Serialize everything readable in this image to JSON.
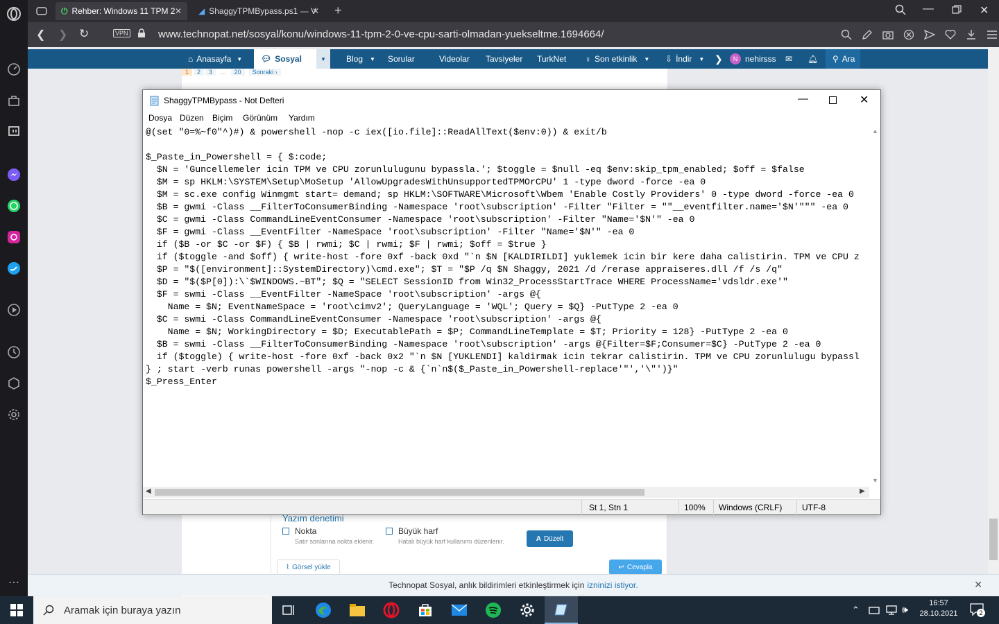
{
  "browser": {
    "tabs": [
      {
        "label": "Rehber: Windows 11 TPM 2"
      },
      {
        "label": "ShaggyTPMBypass.ps1 — V"
      }
    ],
    "vpn_label": "VPN",
    "url": "www.technopat.net/sosyal/konu/windows-11-tpm-2-0-ve-cpu-sarti-olmadan-yuekseltme.1694664/"
  },
  "site_nav": {
    "items": [
      "Anasayfa",
      "Sosyal",
      "Blog",
      "Sorular",
      "Videolar",
      "Tavsiyeler",
      "TurkNet",
      "Son etkinlik",
      "İndir"
    ],
    "user": "nehirsss",
    "user_initial": "N",
    "search": "Ara"
  },
  "pagination": {
    "pages": [
      "1",
      "2",
      "3",
      "...",
      "20"
    ],
    "next": "Sonraki ›"
  },
  "editor_tools": {
    "spell_title": "Yazım denetimi",
    "opt1_label": "Nokta",
    "opt1_desc": "Satır sonlarına nokta eklenir.",
    "opt2_label": "Büyük harf",
    "opt2_desc": "Hatalı büyük harf kullanımı düzenlenir.",
    "fix_button": "Düzelt",
    "image_upload": "Görsel yükle",
    "reply": "Cevapla"
  },
  "notification": {
    "text": "Technopat Sosyal, anlık bildirimleri etkinleştirmek için",
    "link": "izninizi istiyor."
  },
  "notepad": {
    "title": "ShaggyTPMBypass - Not Defteri",
    "menu": [
      "Dosya",
      "Düzen",
      "Biçim",
      "Görünüm",
      "Yardım"
    ],
    "content": "@(set \"0=%~f0\"^)#) & powershell -nop -c iex([io.file]::ReadAllText($env:0)) & exit/b\n\n$_Paste_in_Powershell = { $:code;\n  $N = 'Guncellemeler icin TPM ve CPU zorunlulugunu bypassla.'; $toggle = $null -eq $env:skip_tpm_enabled; $off = $false\n  $M = sp HKLM:\\SYSTEM\\Setup\\MoSetup 'AllowUpgradesWithUnsupportedTPMOrCPU' 1 -type dword -force -ea 0\n  $M = sc.exe config Winmgmt start= demand; sp HKLM:\\SOFTWARE\\Microsoft\\Wbem 'Enable Costly Providers' 0 -type dword -force -ea 0\n  $B = gwmi -Class __FilterToConsumerBinding -Namespace 'root\\subscription' -Filter \"Filter = \"\"__eventfilter.name='$N'\"\"\" -ea 0\n  $C = gwmi -Class CommandLineEventConsumer -Namespace 'root\\subscription' -Filter \"Name='$N'\" -ea 0\n  $F = gwmi -Class __EventFilter -NameSpace 'root\\subscription' -Filter \"Name='$N'\" -ea 0\n  if ($B -or $C -or $F) { $B | rwmi; $C | rwmi; $F | rwmi; $off = $true }\n  if ($toggle -and $off) { write-host -fore 0xf -back 0xd \"`n $N [KALDIRILDI] yuklemek icin bir kere daha calistirin. TPM ve CPU z\n  $P = \"$([environment]::SystemDirectory)\\cmd.exe\"; $T = \"$P /q $N Shaggy, 2021 /d /rerase appraiseres.dll /f /s /q\"\n  $D = \"$($P[0]):\\`$WINDOWS.~BT\"; $Q = \"SELECT SessionID from Win32_ProcessStartTrace WHERE ProcessName='vdsldr.exe'\"\n  $F = swmi -Class __EventFilter -NameSpace 'root\\subscription' -args @{\n    Name = $N; EventNameSpace = 'root\\cimv2'; QueryLanguage = 'WQL'; Query = $Q} -PutType 2 -ea 0\n  $C = swmi -Class CommandLineEventConsumer -Namespace 'root\\subscription' -args @{\n    Name = $N; WorkingDirectory = $D; ExecutablePath = $P; CommandLineTemplate = $T; Priority = 128} -PutType 2 -ea 0\n  $B = swmi -Class __FilterToConsumerBinding -Namespace 'root\\subscription' -args @{Filter=$F;Consumer=$C} -PutType 2 -ea 0\n  if ($toggle) { write-host -fore 0xf -back 0x2 \"`n $N [YUKLENDI] kaldirmak icin tekrar calistirin. TPM ve CPU zorunlulugu bypassl\n} ; start -verb runas powershell -args \"-nop -c & {`n`n$($_Paste_in_Powershell-replace'\"','\\\"')}\"\n$_Press_Enter",
    "status": {
      "position": "St 1, Stn 1",
      "zoom": "100%",
      "line_ending": "Windows (CRLF)",
      "encoding": "UTF-8"
    }
  },
  "taskbar": {
    "search_placeholder": "Aramak için buraya yazın",
    "time": "16:57",
    "date": "28.10.2021",
    "notification_count": "2"
  }
}
